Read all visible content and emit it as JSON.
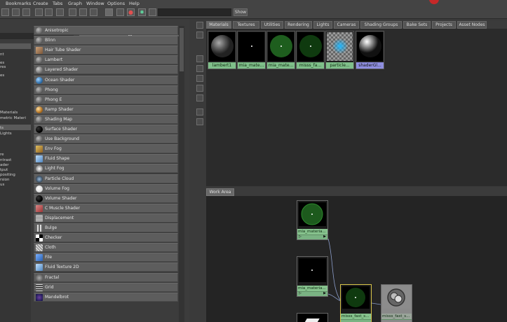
{
  "menu": [
    "Bookmarks",
    "Create",
    "Tabs",
    "Graph",
    "Window",
    "Options",
    "Help"
  ],
  "toolbar": {
    "show_label": "Show"
  },
  "tree": [
    {
      "label": "nt"
    },
    {
      "label": ""
    },
    {
      "label": "es"
    },
    {
      "label": "res"
    },
    {
      "label": ""
    },
    {
      "label": "es"
    },
    {
      "label": ""
    },
    {
      "label": "Materials"
    },
    {
      "label": "metric Materi"
    },
    {
      "label": "ts"
    },
    {
      "label": "Lights"
    },
    {
      "label": "re"
    },
    {
      "label": "ntrast"
    },
    {
      "label": "ader"
    },
    {
      "label": "tput"
    },
    {
      "label": "positing"
    },
    {
      "label": "rsion"
    },
    {
      "label": "us"
    }
  ],
  "shaders": [
    {
      "label": "Anisotropic",
      "icon": "gray-sphere-icon"
    },
    {
      "label": "Blinn",
      "icon": "gray-sphere-icon"
    },
    {
      "label": "Hair Tube Shader",
      "icon": "hair-tube-icon"
    },
    {
      "label": "Lambert",
      "icon": "gray-sphere-icon"
    },
    {
      "label": "Layered Shader",
      "icon": "layered-sphere-icon"
    },
    {
      "label": "Ocean Shader",
      "icon": "ocean-sphere-icon"
    },
    {
      "label": "Phong",
      "icon": "gray-sphere-icon"
    },
    {
      "label": "Phong E",
      "icon": "gray-sphere-icon"
    },
    {
      "label": "Ramp Shader",
      "icon": "ramp-sphere-icon"
    },
    {
      "label": "Shading Map",
      "icon": "gray-sphere-icon"
    },
    {
      "label": "Surface Shader",
      "icon": "black-sphere-icon"
    },
    {
      "label": "Use Background",
      "icon": "gray-sphere-icon"
    },
    {
      "label": "Env Fog",
      "icon": "env-fog-icon"
    },
    {
      "label": "Fluid Shape",
      "icon": "fluid-shape-icon"
    },
    {
      "label": "Light Fog",
      "icon": "light-fog-icon"
    },
    {
      "label": "Particle Cloud",
      "icon": "particle-cloud-icon"
    },
    {
      "label": "Volume Fog",
      "icon": "white-sphere-icon"
    },
    {
      "label": "Volume Shader",
      "icon": "black-sphere-icon"
    },
    {
      "label": "C Muscle Shader",
      "icon": "muscle-icon"
    },
    {
      "label": "Displacement",
      "icon": "displacement-icon"
    },
    {
      "label": "Bulge",
      "icon": "bulge-icon"
    },
    {
      "label": "Checker",
      "icon": "checker-icon"
    },
    {
      "label": "Cloth",
      "icon": "cloth-icon"
    },
    {
      "label": "File",
      "icon": "file-icon"
    },
    {
      "label": "Fluid Texture 2D",
      "icon": "fluid-texture-icon"
    },
    {
      "label": "Fractal",
      "icon": "fractal-icon"
    },
    {
      "label": "Grid",
      "icon": "grid-icon"
    },
    {
      "label": "Mandelbrot",
      "icon": "mandelbrot-icon"
    }
  ],
  "tabs": [
    "Materials",
    "Textures",
    "Utilities",
    "Rendering",
    "Lights",
    "Cameras",
    "Shading Groups",
    "Bake Sets",
    "Projects",
    "Asset Nodes"
  ],
  "materials": [
    {
      "name": "lambert1",
      "kind": "lambert"
    },
    {
      "name": "mia_mate...",
      "kind": "mia-dark"
    },
    {
      "name": "mia_mate...",
      "kind": "mia-green"
    },
    {
      "name": "misss_fa...",
      "kind": "misss-green"
    },
    {
      "name": "particle...",
      "kind": "particle"
    },
    {
      "name": "shaderGl...",
      "kind": "shader-glow"
    }
  ],
  "work_area": {
    "tab_label": "Work Area",
    "nodes": [
      {
        "label": "mia_materia..."
      },
      {
        "label": "mia_materia..."
      },
      {
        "label": "misss_fast_s..."
      },
      {
        "label": "misss_fast_s..."
      }
    ]
  }
}
